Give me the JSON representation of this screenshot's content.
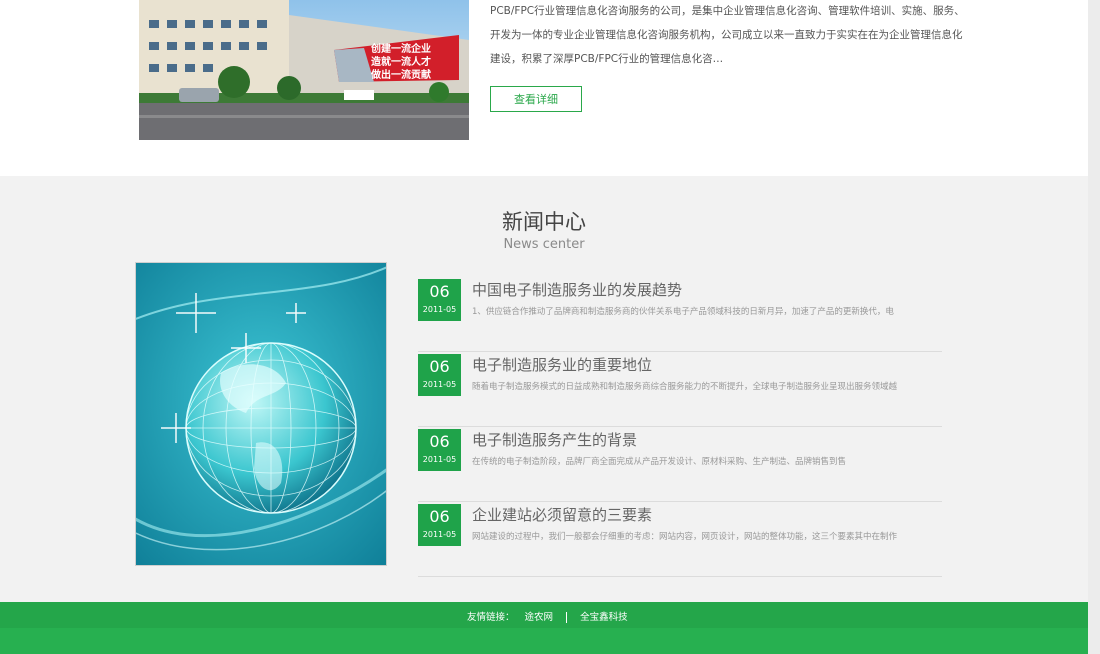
{
  "about": {
    "line1": "PCB/FPC行业管理信息化咨询服务的公司，是集中企业管理信息化咨询、管理软件培训、实施、服务、",
    "line2": "开发为一体的专业企业管理信息化咨询服务机构，公司成立以来一直致力于实实在在为企业管理信息化",
    "line3": "建设，积累了深厚PCB/FPC行业的管理信息化咨…",
    "more_label": "查看详细",
    "sign_line1": "创建一流企业",
    "sign_line2": "造就一流人才",
    "sign_line3": "做出一流贡献"
  },
  "news": {
    "title": "新闻中心",
    "subtitle": "News center",
    "items": [
      {
        "day": "06",
        "ym": "2011-05",
        "title": "中国电子制造服务业的发展趋势",
        "desc": "1、供应链合作推动了品牌商和制造服务商的伙伴关系电子产品领域科技的日新月异，加速了产品的更新换代，电"
      },
      {
        "day": "06",
        "ym": "2011-05",
        "title": "电子制造服务业的重要地位",
        "desc": "随着电子制造服务模式的日益成熟和制造服务商综合服务能力的不断提升，全球电子制造服务业呈现出服务领域越"
      },
      {
        "day": "06",
        "ym": "2011-05",
        "title": "电子制造服务产生的背景",
        "desc": " 在传统的电子制造阶段，品牌厂商全面完成从产品开发设计、原材料采购、生产制造、品牌销售到售"
      },
      {
        "day": "06",
        "ym": "2011-05",
        "title": "企业建站必须留意的三要素",
        "desc": "网站建设的过程中，我们一般都会仔细重的考虑：网站内容，网页设计，网站的整体功能，这三个要素其中在制作"
      }
    ]
  },
  "footer": {
    "links_label": "友情链接：",
    "links": [
      "途农网",
      "全宝鑫科技"
    ]
  },
  "colors": {
    "accent": "#1fa34a",
    "footer": "#24a64a",
    "news_bg": "#f2f2f2"
  }
}
